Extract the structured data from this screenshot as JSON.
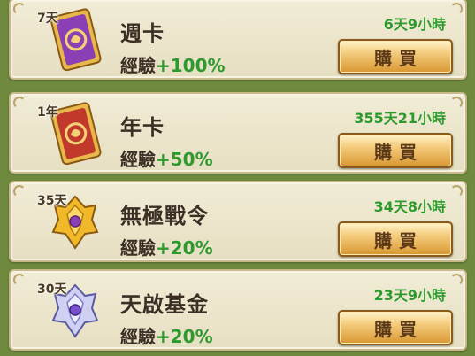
{
  "items": [
    {
      "duration": "7天",
      "title": "週卡",
      "exp_label": "經驗",
      "exp_bonus": "+100%",
      "remaining": "6天9小時",
      "buy_label": "購買",
      "icon": "purple-card-icon",
      "accent": "#8b3fb5"
    },
    {
      "duration": "1年",
      "title": "年卡",
      "exp_label": "經驗",
      "exp_bonus": "+50%",
      "remaining": "355天21小時",
      "buy_label": "購買",
      "icon": "red-card-icon",
      "accent": "#c0392b"
    },
    {
      "duration": "35天",
      "title": "無極戰令",
      "exp_label": "經驗",
      "exp_bonus": "+20%",
      "remaining": "34天8小時",
      "buy_label": "購買",
      "icon": "gold-emblem-icon",
      "accent": "#e6a11f"
    },
    {
      "duration": "30天",
      "title": "天啟基金",
      "exp_label": "經驗",
      "exp_bonus": "+20%",
      "remaining": "23天9小時",
      "buy_label": "購買",
      "icon": "crystal-emblem-icon",
      "accent": "#8e86d8"
    }
  ]
}
